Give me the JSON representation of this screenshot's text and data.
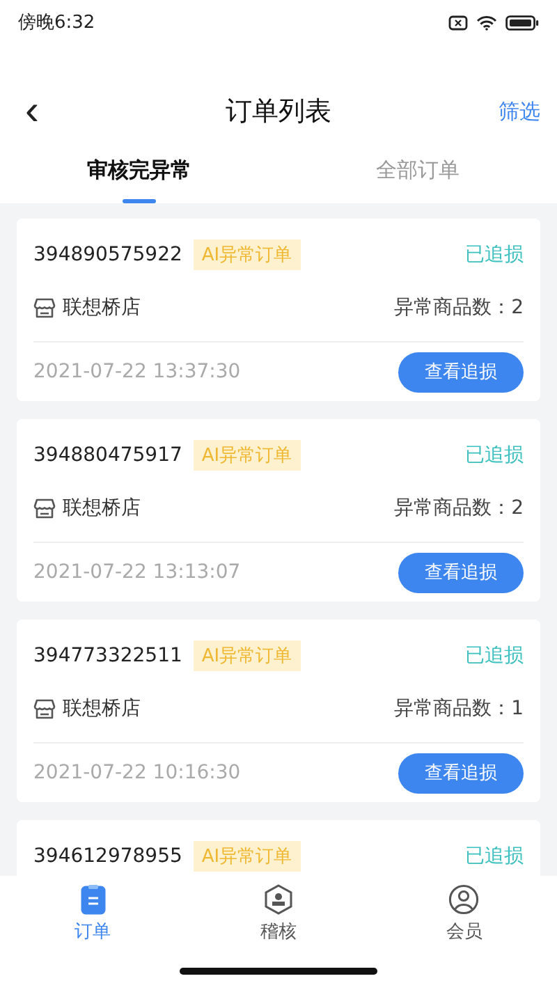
{
  "status_bar": {
    "time": "傍晚6:32"
  },
  "nav": {
    "back": "‹",
    "title": "订单列表",
    "action": "筛选"
  },
  "tabs": [
    {
      "label": "审核完异常",
      "selected": true
    },
    {
      "label": "全部订单",
      "selected": false
    }
  ],
  "orders": [
    {
      "id": "394890575922",
      "tag": "AI异常订单",
      "status": "已追损",
      "store": "联想桥店",
      "count_label": "异常商品数：2",
      "time": "2021-07-22 13:37:30",
      "button": "查看追损"
    },
    {
      "id": "394880475917",
      "tag": "AI异常订单",
      "status": "已追损",
      "store": "联想桥店",
      "count_label": "异常商品数：2",
      "time": "2021-07-22 13:13:07",
      "button": "查看追损"
    },
    {
      "id": "394773322511",
      "tag": "AI异常订单",
      "status": "已追损",
      "store": "联想桥店",
      "count_label": "异常商品数：1",
      "time": "2021-07-22 10:16:30",
      "button": "查看追损"
    },
    {
      "id": "394612978955",
      "tag": "AI异常订单",
      "status": "已追损"
    }
  ],
  "bottom_nav": [
    {
      "label": "订单",
      "kind": "orders",
      "selected": true
    },
    {
      "label": "稽核",
      "kind": "audit",
      "selected": false
    },
    {
      "label": "会员",
      "kind": "member",
      "selected": false
    }
  ]
}
